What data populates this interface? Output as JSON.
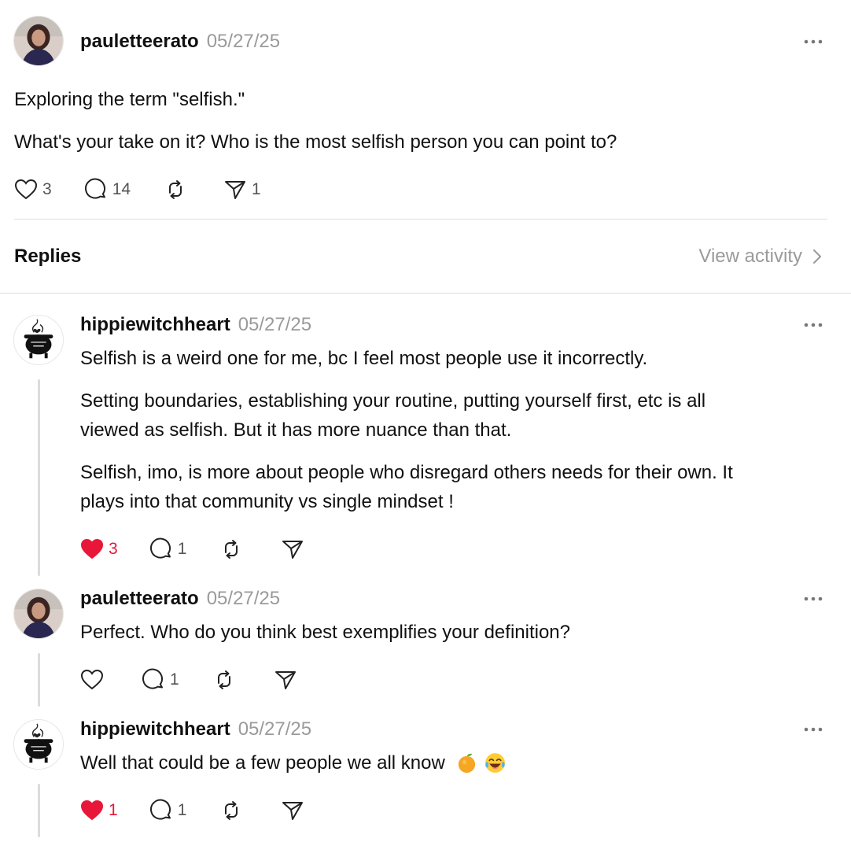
{
  "post": {
    "username": "pauletteerato",
    "date": "05/27/25",
    "lines": [
      "Exploring the term \"selfish.\"",
      "What's your take on it? Who is the most selfish person you can point to?"
    ],
    "likes": "3",
    "comments": "14",
    "shares": "1"
  },
  "replies_header": {
    "title": "Replies",
    "view_activity": "View activity"
  },
  "replies": [
    {
      "username": "hippiewitchheart",
      "date": "05/27/25",
      "paragraphs": [
        [
          "Selfish is a weird one for me, bc I feel most people use it incorrectly."
        ],
        [
          "Setting boundaries, establishing your routine, putting yourself first, etc is all",
          "viewed as selfish. But it has more nuance than that."
        ],
        [
          "Selfish, imo, is more about people who disregard others needs for their own. It",
          "plays into that community vs single mindset !"
        ]
      ],
      "likes": "3",
      "liked": true,
      "comments": "1"
    },
    {
      "username": "pauletteerato",
      "date": "05/27/25",
      "paragraphs": [
        [
          "Perfect. Who do you think best exemplifies your definition?"
        ]
      ],
      "likes": "",
      "liked": false,
      "comments": "1"
    },
    {
      "username": "hippiewitchheart",
      "date": "05/27/25",
      "paragraphs": [
        [
          "Well that could be a few people we all know"
        ]
      ],
      "emojis": [
        "orange-emoji",
        "laughing-tears-emoji"
      ],
      "likes": "1",
      "liked": true,
      "comments": "1"
    }
  ],
  "colors": {
    "accent_like": "#e8173a",
    "muted": "#9a9a9a",
    "divider": "#dedede"
  }
}
